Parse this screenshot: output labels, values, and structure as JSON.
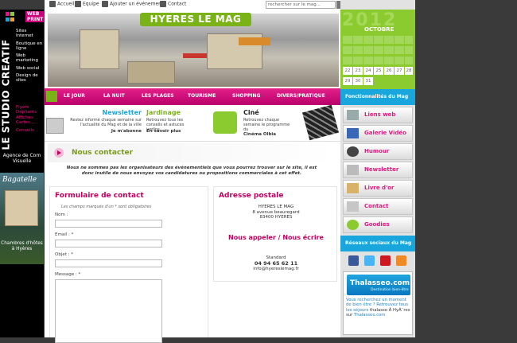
{
  "topbar": {
    "links": [
      "Accueil",
      "Equipe",
      "Ajouter un événement",
      "Contact"
    ],
    "search_placeholder": "rechercher sur le mag..."
  },
  "left_ad": {
    "brand_vertical": "LE STUDIO CREATIF",
    "web_label": "WEB",
    "webprint_label": "WEB PRINT",
    "services_web": [
      "Sites Internet",
      "Boutique en ligne",
      "Web marketing",
      "Web social",
      "Design de sites"
    ],
    "services_print": [
      "Flyers",
      "Dépliants",
      "Affiches",
      "Cartes...",
      "Conseils"
    ],
    "agence": "Agence de Com Visuelle",
    "bagatelle_title": "Bagatelle",
    "bagatelle_caption": "Chambres d'hôtes à Hyères"
  },
  "header": {
    "logo": "HYERES LE MAG"
  },
  "nav": {
    "items": [
      "LE JOUR",
      "LA NUIT",
      "LES PLAGES",
      "TOURISME",
      "SHOPPING",
      "DIVERS/PRATIQUE"
    ]
  },
  "promos": {
    "newsletter": {
      "title": "Newsletter",
      "desc": "Restez informé chaque semaine sur l'actualité du Mag et de la ville",
      "link": "Je m'abonne"
    },
    "jardinage": {
      "title": "Jardinage",
      "desc": "Retrouvez tous les conseils et astuces jardins",
      "link": "En savoir plus"
    },
    "cine": {
      "title": "Ciné",
      "desc": "Retrouvez chaque semaine le programme du",
      "link": "Cinéma Olbia"
    }
  },
  "content": {
    "title": "Nous contacter",
    "intro": "Nous ne sommes pas les organisateurs des événementiels que vous pourrez trouver sur le site, il est donc inutile de nous envoyez vos candidatures ou propositions commerciales à cet effet.",
    "form": {
      "title": "Formulaire de contact",
      "note": "Les champs marqués d'un * sont obligatoires",
      "fields": [
        "Nom :",
        "Email : *",
        "Objet : *",
        "Message : *"
      ]
    },
    "address": {
      "title": "Adresse postale",
      "lines": [
        "HYERES LE MAG",
        "8 avenue beauregard",
        "83400 HYERES"
      ]
    },
    "call": {
      "title": "Nous appeler / Nous écrire",
      "standard": "Standard",
      "phone": "04 94 65 62 11",
      "email": "info@hyereslemag.fr"
    }
  },
  "right": {
    "calendar": {
      "year": "2012",
      "month": "OCTOBRE",
      "days": [
        "22",
        "23",
        "24",
        "25",
        "26",
        "27",
        "28",
        "29",
        "30",
        "31"
      ]
    },
    "functionalities_title": "Fonctionnalités du Mag",
    "buttons": [
      "Liens web",
      "Galerie Vidéo",
      "Humour",
      "Newsletter",
      "Livre d'or",
      "Contact",
      "Goodies"
    ],
    "social_title": "Réseaux sociaux du Mag",
    "thalasseo": {
      "name": "Thalasseo.com",
      "tagline": "Destination bien-être",
      "text_blue": "Vous recherchez un moment de bien être ? Retrouvez tous les séjours",
      "text_dark": "thalasso Ã  HyÃ¨res sur",
      "text_link": "Thalasseo.com"
    }
  },
  "colors": {
    "accent_pink": "#e2197f",
    "accent_green": "#8ccb30",
    "accent_blue": "#18a6dd"
  }
}
